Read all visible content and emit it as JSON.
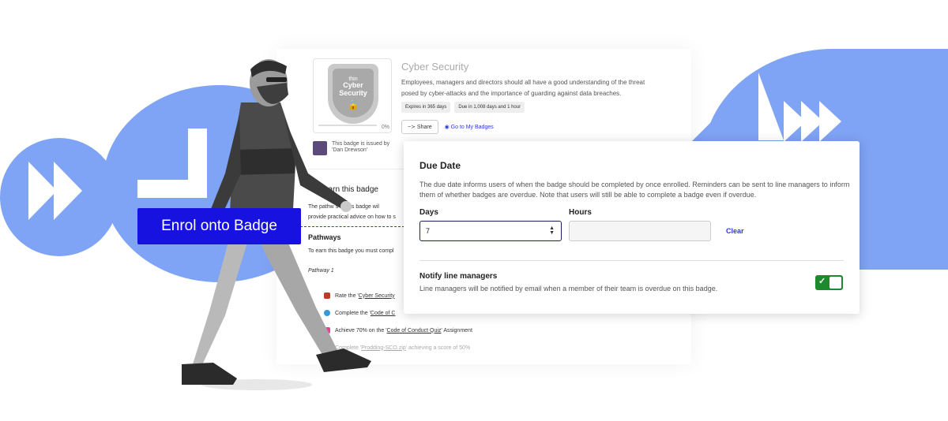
{
  "badge": {
    "title": "Cyber Security",
    "description": "Employees, managers and directors should all have a good understanding of the threat posed by cyber-attacks and the importance of guarding against data breaches.",
    "chips": [
      "Expires in 365 days",
      "Due in 1,008 days and 1 hour"
    ],
    "share_label": "Share",
    "my_badges_label": "Go to My Badges",
    "shield_brand": "thin",
    "shield_text": "Cyber Security",
    "progress_label": "0%",
    "progress": 0,
    "issuer_line": "This badge is issued by",
    "issuer_name": "'Dan Drewson'"
  },
  "earn": {
    "title": "earn this badge",
    "desc_line1": "The pathw",
    "desc_line1b": "s in this badge wil",
    "desc_line2": "provide practical advice on how to s",
    "pathways_title": "Pathways",
    "pathways_desc": "To earn this badge you must compl",
    "pathway_label": "Pathway 1",
    "items": [
      {
        "prefix": "Rate the '",
        "link": "Cyber Security",
        "suffix": "",
        "color": "#c0392b"
      },
      {
        "prefix": "Complete the '",
        "link": "Code of C",
        "suffix": "",
        "color": "#3498db"
      },
      {
        "prefix": "Achieve 70% on the '",
        "link": "Code of Conduct Quiz",
        "suffix": "' Assignment",
        "color": "#e84393"
      },
      {
        "prefix": "Complete '",
        "link": "Prodding-SCO.zip",
        "suffix": "' achieving a score of 50%",
        "color": "#bbbbbb"
      }
    ]
  },
  "enrol_button": "Enrol onto Badge",
  "modal": {
    "title": "Due Date",
    "description": "The due date informs users of when the badge should be completed by once enrolled. Reminders can be sent to line managers to inform them of whether badges are overdue. Note that users will still be able to complete a badge even if overdue.",
    "days_label": "Days",
    "days_value": "7",
    "hours_label": "Hours",
    "hours_value": "",
    "clear_label": "Clear",
    "notify_title": "Notify line managers",
    "notify_desc": "Line managers will be notified by email when a member of their team is overdue on this badge.",
    "notify_enabled": true
  },
  "colors": {
    "accent_blue": "#1712e0",
    "shape_blue": "#7fa3f5",
    "link_blue": "#2a3bd8",
    "toggle_green": "#1d8a2e"
  },
  "icons": [
    "play-icon",
    "share-icon",
    "badge-icon",
    "check-icon",
    "spinner-icon"
  ]
}
